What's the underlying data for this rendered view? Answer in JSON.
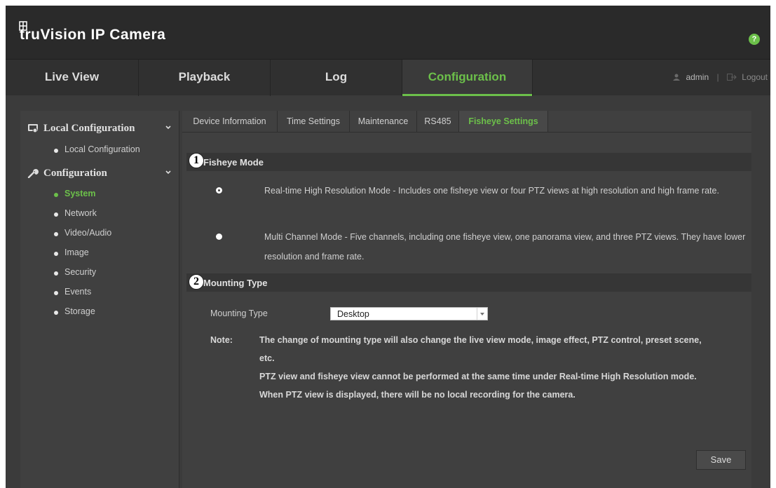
{
  "header": {
    "brand": "truVision IP Camera",
    "help": "?"
  },
  "nav": {
    "tabs": [
      "Live View",
      "Playback",
      "Log",
      "Configuration"
    ],
    "active": "Configuration",
    "user": "admin",
    "logout": "Logout"
  },
  "sidebar": {
    "groups": [
      {
        "label": "Local Configuration",
        "icon": "local-config-icon",
        "items": [
          "Local Configuration"
        ]
      },
      {
        "label": "Configuration",
        "icon": "wrench-icon",
        "items": [
          "System",
          "Network",
          "Video/Audio",
          "Image",
          "Security",
          "Events",
          "Storage"
        ]
      }
    ],
    "active_item": "System"
  },
  "tabs": [
    "Device Information",
    "Time Settings",
    "Maintenance",
    "RS485",
    "Fisheye Settings"
  ],
  "active_tab": "Fisheye Settings",
  "fisheye_mode": {
    "callout": "1",
    "title": "Fisheye Mode",
    "options": [
      {
        "text": "Real-time High Resolution Mode - Includes one fisheye view or four PTZ views at high resolution and high frame rate.",
        "selected": true
      },
      {
        "text": "Multi Channel Mode - Five channels, including one fisheye view, one panorama view, and three PTZ views. They have lower resolution and frame rate.",
        "selected": false
      }
    ]
  },
  "mounting": {
    "callout": "2",
    "title": "Mounting Type",
    "field_label": "Mounting Type",
    "value": "Desktop",
    "note_label": "Note:",
    "note_lines": [
      "The change of mounting type will also change the live view mode, image effect, PTZ control, preset scene, etc.",
      "PTZ view and fisheye view cannot be performed at the same time under Real-time High Resolution mode. When PTZ view is displayed, there will be no local recording for the camera."
    ]
  },
  "save_label": "Save",
  "colors": {
    "accent": "#6cc04a",
    "background": "#404040",
    "header": "#2a2a2a"
  }
}
